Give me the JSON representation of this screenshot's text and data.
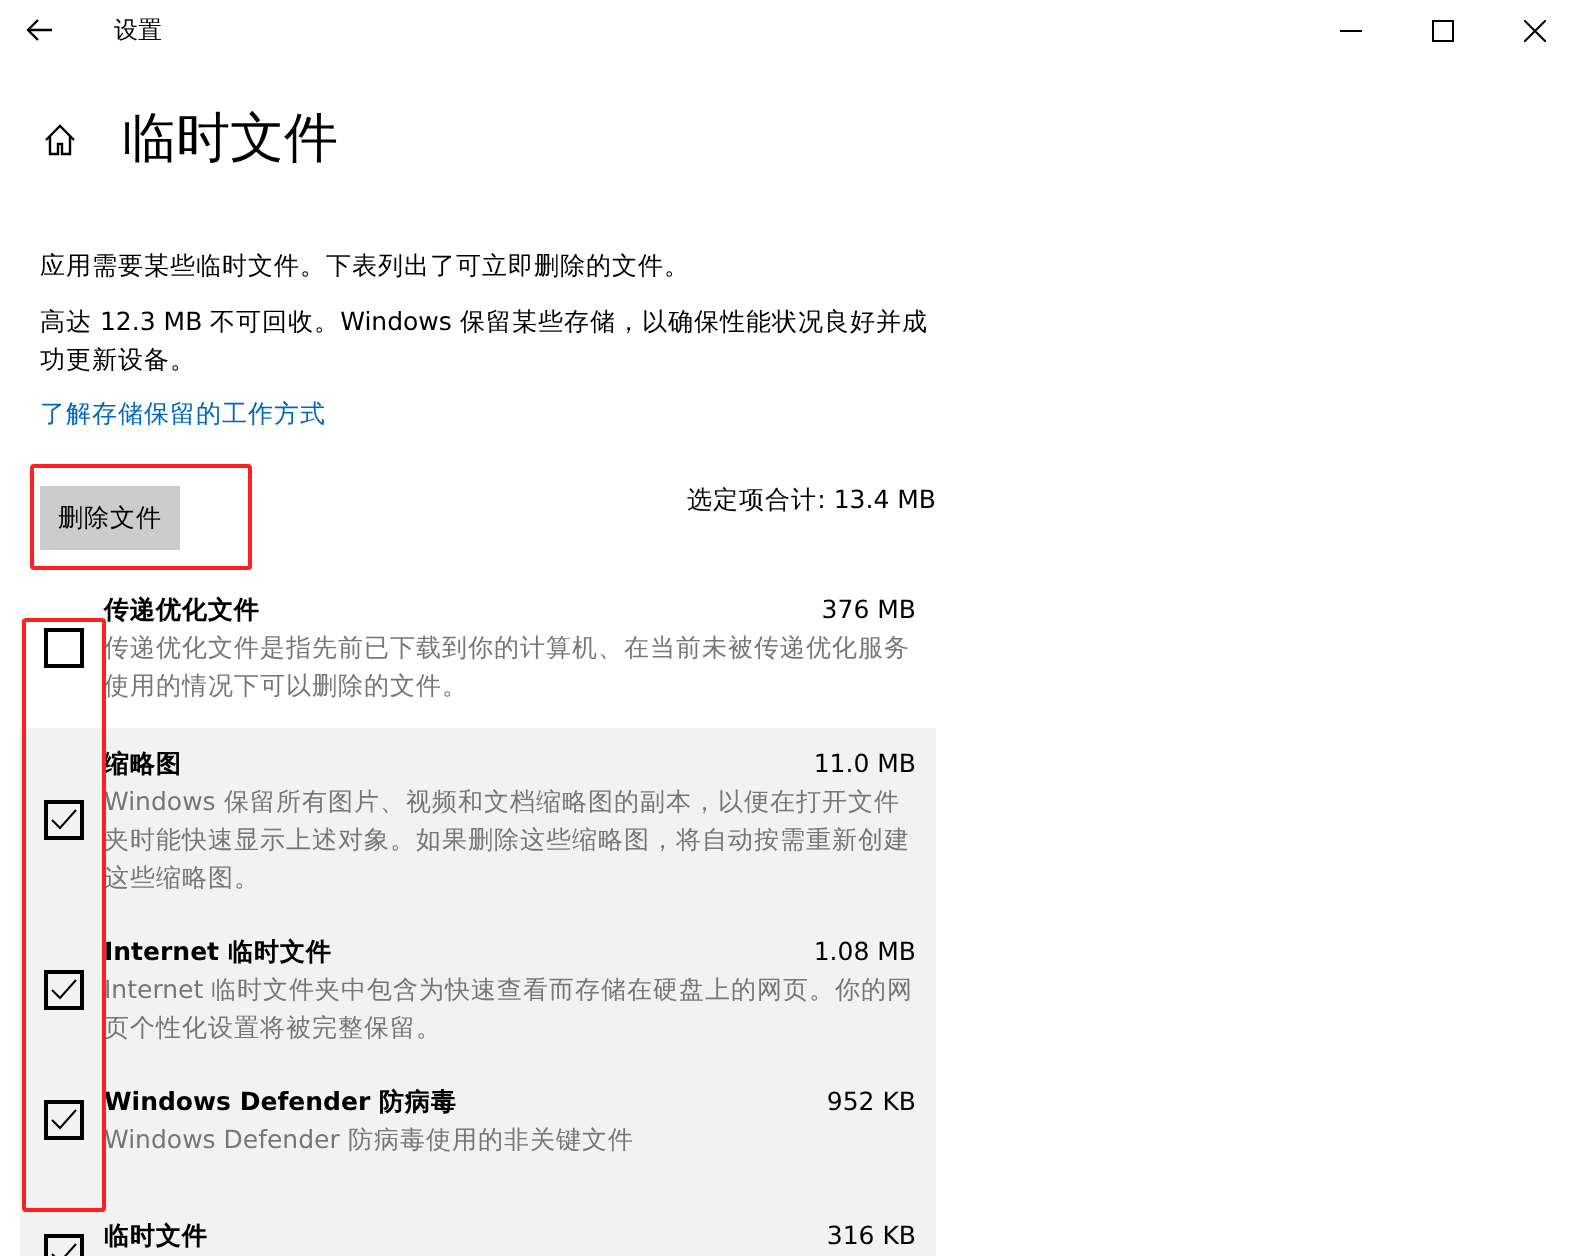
{
  "window": {
    "title": "设置"
  },
  "page": {
    "title": "临时文件"
  },
  "intro": [
    "应用需要某些临时文件。下表列出了可立即删除的文件。",
    "高达 12.3 MB 不可回收。Windows 保留某些存储，以确保性能状况良好并成功更新设备。"
  ],
  "link": "了解存储保留的工作方式",
  "delete_button": "删除文件",
  "selected_total": "选定项合计: 13.4 MB",
  "items": [
    {
      "name": "传递优化文件",
      "size": "376 MB",
      "description": "传递优化文件是指先前已下载到你的计算机、在当前未被传递优化服务使用的情况下可以删除的文件。",
      "checked": false
    },
    {
      "name": "缩略图",
      "size": "11.0 MB",
      "description": "Windows 保留所有图片、视频和文档缩略图的副本，以便在打开文件夹时能快速显示上述对象。如果删除这些缩略图，将自动按需重新创建这些缩略图。",
      "checked": true
    },
    {
      "name": "Internet 临时文件",
      "size": "1.08 MB",
      "description": "Internet 临时文件夹中包含为快速查看而存储在硬盘上的网页。你的网页个性化设置将被完整保留。",
      "checked": true
    },
    {
      "name": "Windows Defender 防病毒",
      "size": "952 KB",
      "description": "Windows Defender 防病毒使用的非关键文件",
      "checked": true
    },
    {
      "name": "临时文件",
      "size": "316 KB",
      "checked": true
    }
  ]
}
